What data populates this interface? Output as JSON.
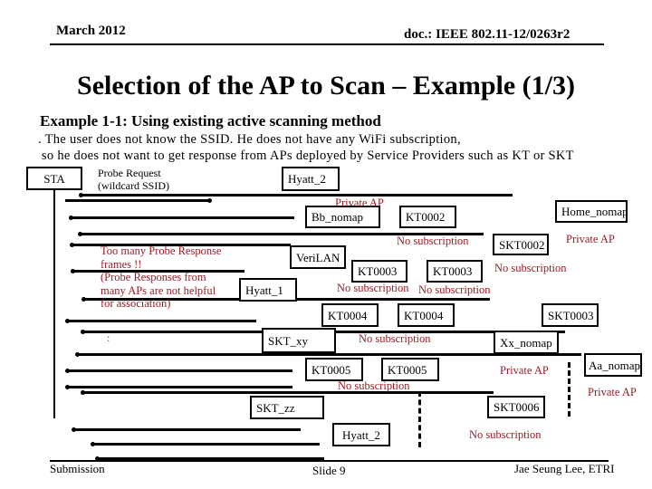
{
  "header": {
    "date": "March 2012",
    "doc_id": "doc.: IEEE 802.11-12/0263r2"
  },
  "title": "Selection of the AP to Scan – Example (1/3)",
  "example": {
    "heading": "Example 1-1: Using existing active scanning method",
    "line1": ". The user does not know the SSID. He does not have any WiFi subscription,",
    "line2": " so he does not want to get response from APs deployed by Service Providers such as KT or SKT"
  },
  "diagram": {
    "sta_label": "STA",
    "probe_request_label_1": "Probe Request",
    "probe_request_label_2": "(wildcard SSID)",
    "note": {
      "line1": "Too many Probe Response",
      "line2": "frames !!",
      "line3": "(Probe Responses from",
      "line4": "many APs are not helpful",
      "line5": "for association)"
    },
    "ellipsis": ":",
    "aps": [
      {
        "name": "Hyatt_2"
      },
      {
        "name": "Bb_nomap"
      },
      {
        "name": "KT0002"
      },
      {
        "name": "Home_nomap"
      },
      {
        "name": "SKT0002"
      },
      {
        "name": "VeriLAN"
      },
      {
        "name": "KT0003"
      },
      {
        "name": "KT0003"
      },
      {
        "name": "Hyatt_1"
      },
      {
        "name": "KT0004"
      },
      {
        "name": "KT0004"
      },
      {
        "name": "SKT0003"
      },
      {
        "name": "SKT_xy"
      },
      {
        "name": "Xx_nomap"
      },
      {
        "name": "KT0005"
      },
      {
        "name": "KT0005"
      },
      {
        "name": "Aa_nomap"
      },
      {
        "name": "SKT0006"
      },
      {
        "name": "SKT_zz"
      },
      {
        "name": "Hyatt_2"
      }
    ],
    "annotations": {
      "private_ap_bb": "Private AP",
      "no_sub_kt0002": "No subscription",
      "private_ap_home": "Private AP",
      "no_sub_skt0002": "No subscription",
      "no_sub_kt0003a": "No subscription",
      "no_sub_kt0003b": "No subscription",
      "no_sub_kt0004": "No subscription",
      "no_sub_kt0005": "No subscription",
      "private_ap_xx": "Private AP",
      "private_ap_aa": "Private AP",
      "no_sub_skt0006": "No subscription"
    }
  },
  "footer": {
    "left": "Submission",
    "center": "Slide 9",
    "right": "Jae Seung Lee, ETRI"
  }
}
